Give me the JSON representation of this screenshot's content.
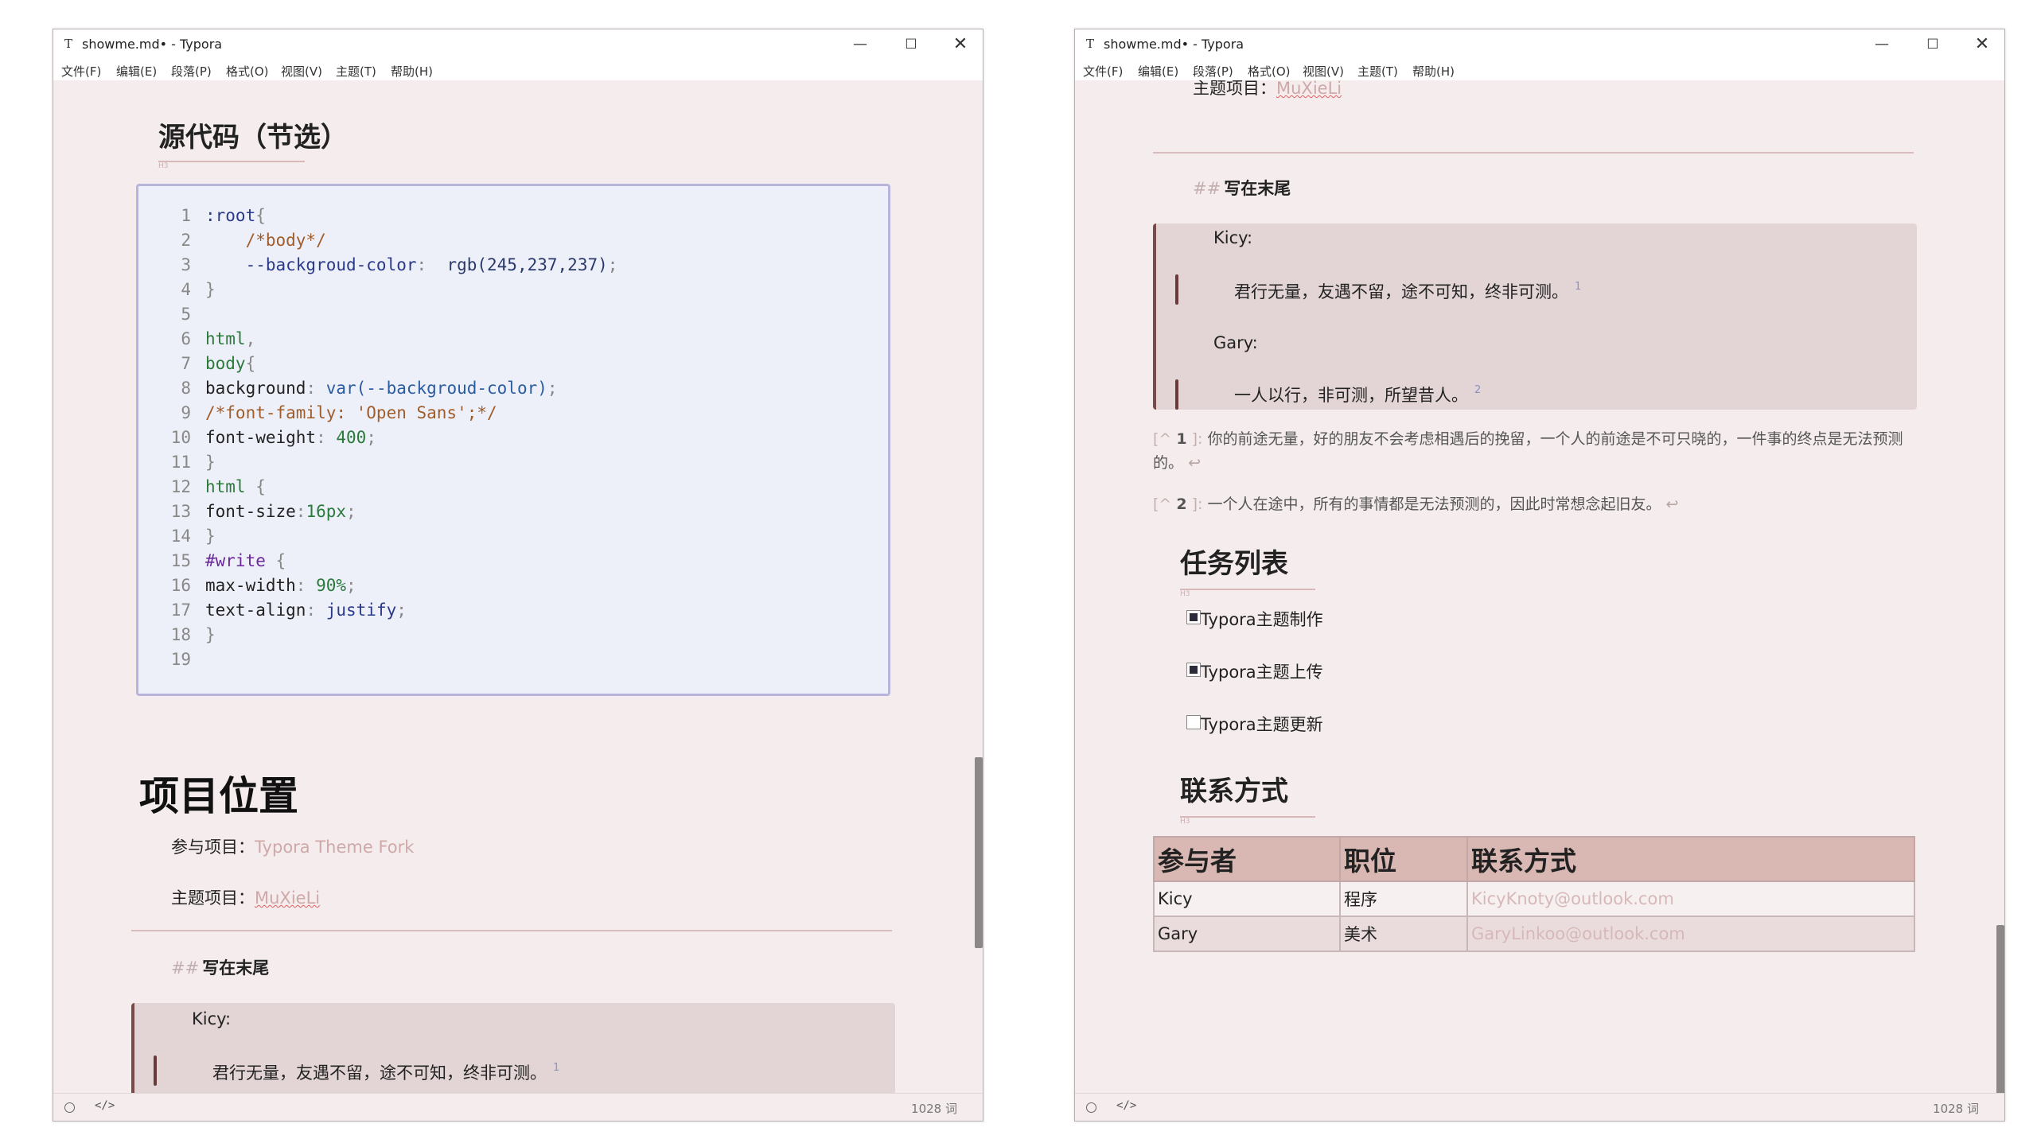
{
  "window": {
    "title": "showme.md• - Typora",
    "app_icon": "T",
    "menu": [
      "文件(F)",
      "编辑(E)",
      "段落(P)",
      "格式(O)",
      "视图(V)",
      "主题(T)",
      "帮助(H)"
    ],
    "word_count": "1028 词",
    "icons": [
      "typora-app-icon",
      "minimize-icon",
      "maximize-icon",
      "close-icon",
      "circle-icon",
      "source-code-icon"
    ]
  },
  "left": {
    "source_heading": "源代码（节选）",
    "heading_mark": "H3",
    "code_lines": [
      {
        "n": "1",
        "tokens": [
          {
            "c": "t-kw",
            "t": ":root"
          },
          {
            "c": "t-punc",
            "t": "{"
          }
        ]
      },
      {
        "n": "2",
        "tokens": [
          {
            "c": "t-com",
            "t": "    /*body*/"
          }
        ]
      },
      {
        "n": "3",
        "tokens": [
          {
            "c": "t-kw",
            "t": "    --backgroud-color"
          },
          {
            "c": "t-punc",
            "t": ":  "
          },
          {
            "c": "t-rgb",
            "t": "rgb(245,237,237)"
          },
          {
            "c": "t-punc",
            "t": ";"
          }
        ]
      },
      {
        "n": "4",
        "tokens": [
          {
            "c": "t-punc",
            "t": "}"
          }
        ]
      },
      {
        "n": "5",
        "tokens": []
      },
      {
        "n": "6",
        "tokens": [
          {
            "c": "t-val",
            "t": "html"
          },
          {
            "c": "t-punc",
            "t": ","
          }
        ]
      },
      {
        "n": "7",
        "tokens": [
          {
            "c": "t-val",
            "t": "body"
          },
          {
            "c": "t-punc",
            "t": "{"
          }
        ]
      },
      {
        "n": "8",
        "tokens": [
          {
            "c": "t-prop",
            "t": "background"
          },
          {
            "c": "t-punc",
            "t": ": "
          },
          {
            "c": "t-fn",
            "t": "var(--backgroud-color)"
          },
          {
            "c": "t-punc",
            "t": ";"
          }
        ]
      },
      {
        "n": "9",
        "tokens": [
          {
            "c": "t-com",
            "t": "/*font-family: 'Open Sans';*/"
          }
        ]
      },
      {
        "n": "10",
        "tokens": [
          {
            "c": "t-prop",
            "t": "font-weight"
          },
          {
            "c": "t-punc",
            "t": ": "
          },
          {
            "c": "t-val",
            "t": "400"
          },
          {
            "c": "t-punc",
            "t": ";"
          }
        ]
      },
      {
        "n": "11",
        "tokens": [
          {
            "c": "t-punc",
            "t": "}"
          }
        ]
      },
      {
        "n": "12",
        "tokens": [
          {
            "c": "t-val",
            "t": "html"
          },
          {
            "c": "t-punc",
            "t": " {"
          }
        ]
      },
      {
        "n": "13",
        "tokens": [
          {
            "c": "t-prop",
            "t": "font-size"
          },
          {
            "c": "t-punc",
            "t": ":"
          },
          {
            "c": "t-val",
            "t": "16px"
          },
          {
            "c": "t-punc",
            "t": ";"
          }
        ]
      },
      {
        "n": "14",
        "tokens": [
          {
            "c": "t-punc",
            "t": "}"
          }
        ]
      },
      {
        "n": "15",
        "tokens": [
          {
            "c": "t-hash",
            "t": "#write"
          },
          {
            "c": "t-punc",
            "t": " {"
          }
        ]
      },
      {
        "n": "16",
        "tokens": [
          {
            "c": "t-prop",
            "t": "max-width"
          },
          {
            "c": "t-punc",
            "t": ": "
          },
          {
            "c": "t-val",
            "t": "90%"
          },
          {
            "c": "t-punc",
            "t": ";"
          }
        ]
      },
      {
        "n": "17",
        "tokens": [
          {
            "c": "t-prop",
            "t": "text-align"
          },
          {
            "c": "t-punc",
            "t": ": "
          },
          {
            "c": "t-kw",
            "t": "justify"
          },
          {
            "c": "t-punc",
            "t": ";"
          }
        ]
      },
      {
        "n": "18",
        "tokens": [
          {
            "c": "t-punc",
            "t": "}"
          }
        ]
      },
      {
        "n": "19",
        "tokens": []
      }
    ],
    "project_heading": "项目位置",
    "participate_label": "参与项目：",
    "participate_link": "Typora Theme Fork",
    "theme_label": "主题项目：",
    "theme_link": "MuXieLi",
    "end_hashes": "##",
    "end_heading": "写在末尾",
    "quote_speaker": "Kicy:",
    "quote_text": "君行无量，友遇不留，途不可知，终非可测。",
    "quote_sup": "1"
  },
  "right": {
    "theme_label": "主题项目：",
    "theme_link": "MuXieLi",
    "end_hashes": "##",
    "end_heading": "写在末尾",
    "quote1_speaker": "Kicy:",
    "quote1_text": "君行无量，友遇不留，途不可知，终非可测。",
    "quote1_sup": "1",
    "quote2_speaker": "Gary:",
    "quote2_text": "一人以行，非可测，所望昔人。",
    "quote2_sup": "2",
    "footnotes": [
      {
        "mark_open": "[^",
        "num": "1",
        "mark_close": "]:",
        "text": "你的前途无量，好的朋友不会考虑相遇后的挽留，一个人的前途是不可只晓的，一件事的终点是无法预测的。",
        "back": "↩"
      },
      {
        "mark_open": "[^",
        "num": "2",
        "mark_close": "]:",
        "text": "一个人在途中，所有的事情都是无法预测的，因此时常想念起旧友。",
        "back": "↩"
      }
    ],
    "task_heading": "任务列表",
    "heading_mark": "H3",
    "tasks": [
      {
        "label": "Typora主题制作",
        "checked": true
      },
      {
        "label": "Typora主题上传",
        "checked": true
      },
      {
        "label": "Typora主题更新",
        "checked": false
      }
    ],
    "contact_heading": "联系方式",
    "table": {
      "headers": [
        "参与者",
        "职位",
        "联系方式"
      ],
      "rows": [
        [
          "Kicy",
          "程序",
          "KicyKnoty@outlook.com"
        ],
        [
          "Gary",
          "美术",
          "GaryLinkoo@outlook.com"
        ]
      ]
    }
  }
}
